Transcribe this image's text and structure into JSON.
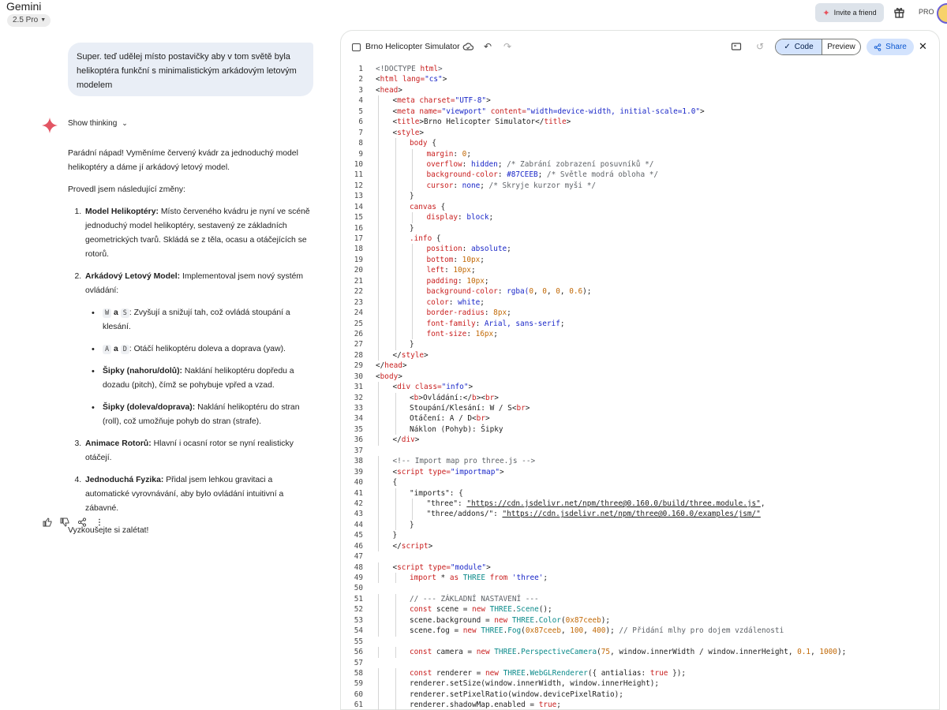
{
  "header": {
    "app_name": "Gemini",
    "model": "2.5 Pro",
    "invite_label": "Invite a friend",
    "pro_label": "PRO"
  },
  "chat": {
    "user_message": "Super. teď udělej místo postavičky aby v tom světě byla helikoptéra funkční s minimalistickým arkádovým letovým modelem",
    "show_thinking_label": "Show thinking",
    "intro": "Parádní nápad! Vyměníme červený kvádr za jednoduchý model helikoptéry a dáme jí arkádový letový model.",
    "changes_heading": "Provedl jsem následující změny:",
    "items": [
      {
        "title": "Model Helikoptéry:",
        "text": " Místo červeného kvádru je nyní ve scéně jednoduchý model helikoptéry, sestavený ze základních geometrických tvarů. Skládá se z těla, ocasu a otáčejících se rotorů."
      },
      {
        "title": "Arkádový Letový Model:",
        "text": " Implementoval jsem nový systém ovládání:"
      },
      {
        "title": "Animace Rotorů:",
        "text": " Hlavní i ocasní rotor se nyní realisticky otáčejí."
      },
      {
        "title": "Jednoduchá Fyzika:",
        "text": " Přidal jsem lehkou gravitaci a automatické vyrovnávání, aby bylo ovládání intuitivní a zábavné."
      }
    ],
    "controls": {
      "ws_key1": "W",
      "ws_conj": "a",
      "ws_key2": "S",
      "ws_text": ": Zvyšují a snižují tah, což ovládá stoupání a klesání.",
      "ad_key1": "A",
      "ad_conj": "a",
      "ad_key2": "D",
      "ad_text": ": Otáčí helikoptéru doleva a doprava (yaw).",
      "ud_title": "Šipky (nahoru/dolů):",
      "ud_text": " Naklání helikoptéru dopředu a dozadu (pitch), čímž se pohybuje vpřed a vzad.",
      "lr_title": "Šipky (doleva/doprava):",
      "lr_text": " Naklání helikoptéru do stran (roll), což umožňuje pohyb do stran (strafe)."
    },
    "outro": "Vyzkoušejte si zalétat!"
  },
  "editor": {
    "file_title": "Brno Helicopter Simulator",
    "code_tab": "Code",
    "preview_tab": "Preview",
    "share_label": "Share"
  },
  "colors": {
    "keyword": "#c92020",
    "attr": "#c92020",
    "string": "#1a27c8",
    "number": "#c26a08",
    "comment": "#5f6368",
    "klass": "#0b8a8a",
    "plain": "#1f1f1f",
    "prop": "#c92020"
  },
  "code_lines": [
    [
      [
        "<!DOCTYPE ",
        "comment"
      ],
      [
        "html",
        "keyword"
      ],
      [
        ">",
        "comment"
      ]
    ],
    [
      [
        "<",
        "plain"
      ],
      [
        "html",
        "keyword"
      ],
      [
        " lang=",
        "attr"
      ],
      [
        "\"cs\"",
        "string"
      ],
      [
        ">",
        "plain"
      ]
    ],
    [
      [
        "<",
        "plain"
      ],
      [
        "head",
        "keyword"
      ],
      [
        ">",
        "plain"
      ]
    ],
    [
      [
        "<",
        "plain"
      ],
      [
        "meta",
        "keyword"
      ],
      [
        " charset=",
        "attr"
      ],
      [
        "\"UTF-8\"",
        "string"
      ],
      [
        ">",
        "plain"
      ]
    ],
    [
      [
        "<",
        "plain"
      ],
      [
        "meta",
        "keyword"
      ],
      [
        " name=",
        "attr"
      ],
      [
        "\"viewport\"",
        "string"
      ],
      [
        " content=",
        "attr"
      ],
      [
        "\"width=device-width, initial-scale=1.0\"",
        "string"
      ],
      [
        ">",
        "plain"
      ]
    ],
    [
      [
        "<",
        "plain"
      ],
      [
        "title",
        "keyword"
      ],
      [
        ">Brno Helicopter Simulator</",
        "plain"
      ],
      [
        "title",
        "keyword"
      ],
      [
        ">",
        "plain"
      ]
    ],
    [
      [
        "<",
        "plain"
      ],
      [
        "style",
        "keyword"
      ],
      [
        ">",
        "plain"
      ]
    ],
    [
      [
        "body",
        "keyword"
      ],
      [
        " {",
        "plain"
      ]
    ],
    [
      [
        "margin",
        "prop"
      ],
      [
        ": ",
        "plain"
      ],
      [
        "0",
        "number"
      ],
      [
        ";",
        "plain"
      ]
    ],
    [
      [
        "overflow",
        "prop"
      ],
      [
        ": ",
        "plain"
      ],
      [
        "hidden",
        "string"
      ],
      [
        "; ",
        "plain"
      ],
      [
        "/* Zabrání zobrazení posuvníků */",
        "comment"
      ]
    ],
    [
      [
        "background-color",
        "prop"
      ],
      [
        ": ",
        "plain"
      ],
      [
        "#87CEEB",
        "string"
      ],
      [
        "; ",
        "plain"
      ],
      [
        "/* Světle modrá obloha */",
        "comment"
      ]
    ],
    [
      [
        "cursor",
        "prop"
      ],
      [
        ": ",
        "plain"
      ],
      [
        "none",
        "string"
      ],
      [
        "; ",
        "plain"
      ],
      [
        "/* Skryje kurzor myši */",
        "comment"
      ]
    ],
    [
      [
        "}",
        "plain"
      ]
    ],
    [
      [
        "canvas",
        "keyword"
      ],
      [
        " {",
        "plain"
      ]
    ],
    [
      [
        "display",
        "prop"
      ],
      [
        ": ",
        "plain"
      ],
      [
        "block",
        "string"
      ],
      [
        ";",
        "plain"
      ]
    ],
    [
      [
        "}",
        "plain"
      ]
    ],
    [
      [
        ".info",
        "keyword"
      ],
      [
        " {",
        "plain"
      ]
    ],
    [
      [
        "position",
        "prop"
      ],
      [
        ": ",
        "plain"
      ],
      [
        "absolute",
        "string"
      ],
      [
        ";",
        "plain"
      ]
    ],
    [
      [
        "bottom",
        "prop"
      ],
      [
        ": ",
        "plain"
      ],
      [
        "10px",
        "number"
      ],
      [
        ";",
        "plain"
      ]
    ],
    [
      [
        "left",
        "prop"
      ],
      [
        ": ",
        "plain"
      ],
      [
        "10px",
        "number"
      ],
      [
        ";",
        "plain"
      ]
    ],
    [
      [
        "padding",
        "prop"
      ],
      [
        ": ",
        "plain"
      ],
      [
        "10px",
        "number"
      ],
      [
        ";",
        "plain"
      ]
    ],
    [
      [
        "background-color",
        "prop"
      ],
      [
        ": ",
        "plain"
      ],
      [
        "rgba(",
        "string"
      ],
      [
        "0",
        "number"
      ],
      [
        ", ",
        "plain"
      ],
      [
        "0",
        "number"
      ],
      [
        ", ",
        "plain"
      ],
      [
        "0",
        "number"
      ],
      [
        ", ",
        "plain"
      ],
      [
        "0.6",
        "number"
      ],
      [
        ");",
        "plain"
      ]
    ],
    [
      [
        "color",
        "prop"
      ],
      [
        ": ",
        "plain"
      ],
      [
        "white",
        "string"
      ],
      [
        ";",
        "plain"
      ]
    ],
    [
      [
        "border-radius",
        "prop"
      ],
      [
        ": ",
        "plain"
      ],
      [
        "8px",
        "number"
      ],
      [
        ";",
        "plain"
      ]
    ],
    [
      [
        "font-family",
        "prop"
      ],
      [
        ": ",
        "plain"
      ],
      [
        "Arial, sans-serif",
        "string"
      ],
      [
        ";",
        "plain"
      ]
    ],
    [
      [
        "font-size",
        "prop"
      ],
      [
        ": ",
        "plain"
      ],
      [
        "16px",
        "number"
      ],
      [
        ";",
        "plain"
      ]
    ],
    [
      [
        "}",
        "plain"
      ]
    ],
    [
      [
        "</",
        "plain"
      ],
      [
        "style",
        "keyword"
      ],
      [
        ">",
        "plain"
      ]
    ],
    [
      [
        "</",
        "plain"
      ],
      [
        "head",
        "keyword"
      ],
      [
        ">",
        "plain"
      ]
    ],
    [
      [
        "<",
        "plain"
      ],
      [
        "body",
        "keyword"
      ],
      [
        ">",
        "plain"
      ]
    ],
    [
      [
        "<",
        "plain"
      ],
      [
        "div",
        "keyword"
      ],
      [
        " class=",
        "attr"
      ],
      [
        "\"info\"",
        "string"
      ],
      [
        ">",
        "plain"
      ]
    ],
    [
      [
        "<",
        "plain"
      ],
      [
        "b",
        "keyword"
      ],
      [
        ">Ovládání:</",
        "plain"
      ],
      [
        "b",
        "keyword"
      ],
      [
        "><",
        "plain"
      ],
      [
        "br",
        "keyword"
      ],
      [
        ">",
        "plain"
      ]
    ],
    [
      [
        "Stoupání/Klesání: W / S<",
        "plain"
      ],
      [
        "br",
        "keyword"
      ],
      [
        ">",
        "plain"
      ]
    ],
    [
      [
        "Otáčení: A / D<",
        "plain"
      ],
      [
        "br",
        "keyword"
      ],
      [
        ">",
        "plain"
      ]
    ],
    [
      [
        "Náklon (Pohyb): Šipky",
        "plain"
      ]
    ],
    [
      [
        "</",
        "plain"
      ],
      [
        "div",
        "keyword"
      ],
      [
        ">",
        "plain"
      ]
    ],
    [
      [
        "",
        "plain"
      ]
    ],
    [
      [
        "<!-- Import map pro three.js -->",
        "comment"
      ]
    ],
    [
      [
        "<",
        "plain"
      ],
      [
        "script",
        "keyword"
      ],
      [
        " type=",
        "attr"
      ],
      [
        "\"importmap\"",
        "string"
      ],
      [
        ">",
        "plain"
      ]
    ],
    [
      [
        "{",
        "plain"
      ]
    ],
    [
      [
        "\"imports\": {",
        "plain"
      ]
    ],
    [
      [
        "\"three\": ",
        "plain"
      ],
      [
        "\"https://cdn.jsdelivr.net/npm/three@0.160.0/build/three.module.js\"",
        "plain"
      ],
      [
        ",",
        "plain"
      ]
    ],
    [
      [
        "\"three/addons/\": ",
        "plain"
      ],
      [
        "\"https://cdn.jsdelivr.net/npm/three@0.160.0/examples/jsm/\"",
        "plain"
      ]
    ],
    [
      [
        "}",
        "plain"
      ]
    ],
    [
      [
        "}",
        "plain"
      ]
    ],
    [
      [
        "</",
        "plain"
      ],
      [
        "script",
        "keyword"
      ],
      [
        ">",
        "plain"
      ]
    ],
    [
      [
        "",
        "plain"
      ]
    ],
    [
      [
        "<",
        "plain"
      ],
      [
        "script",
        "keyword"
      ],
      [
        " type=",
        "attr"
      ],
      [
        "\"module\"",
        "string"
      ],
      [
        ">",
        "plain"
      ]
    ],
    [
      [
        "import",
        "keyword"
      ],
      [
        " * ",
        "plain"
      ],
      [
        "as",
        "keyword"
      ],
      [
        " ",
        "plain"
      ],
      [
        "THREE",
        "klass"
      ],
      [
        " ",
        "plain"
      ],
      [
        "from",
        "keyword"
      ],
      [
        " ",
        "plain"
      ],
      [
        "'three'",
        "string"
      ],
      [
        ";",
        "plain"
      ]
    ],
    [
      [
        "",
        "plain"
      ]
    ],
    [
      [
        "// --- ZÁKLADNÍ NASTAVENÍ ---",
        "comment"
      ]
    ],
    [
      [
        "const",
        "keyword"
      ],
      [
        " scene = ",
        "plain"
      ],
      [
        "new",
        "keyword"
      ],
      [
        " ",
        "plain"
      ],
      [
        "THREE",
        "klass"
      ],
      [
        ".",
        "plain"
      ],
      [
        "Scene",
        "klass"
      ],
      [
        "();",
        "plain"
      ]
    ],
    [
      [
        "scene.background = ",
        "plain"
      ],
      [
        "new",
        "keyword"
      ],
      [
        " ",
        "plain"
      ],
      [
        "THREE",
        "klass"
      ],
      [
        ".",
        "plain"
      ],
      [
        "Color",
        "klass"
      ],
      [
        "(",
        "plain"
      ],
      [
        "0x87ceeb",
        "number"
      ],
      [
        ");",
        "plain"
      ]
    ],
    [
      [
        "scene.fog = ",
        "plain"
      ],
      [
        "new",
        "keyword"
      ],
      [
        " ",
        "plain"
      ],
      [
        "THREE",
        "klass"
      ],
      [
        ".",
        "plain"
      ],
      [
        "Fog",
        "klass"
      ],
      [
        "(",
        "plain"
      ],
      [
        "0x87ceeb",
        "number"
      ],
      [
        ", ",
        "plain"
      ],
      [
        "100",
        "number"
      ],
      [
        ", ",
        "plain"
      ],
      [
        "400",
        "number"
      ],
      [
        "); ",
        "plain"
      ],
      [
        "// Přidání mlhy pro dojem vzdálenosti",
        "comment"
      ]
    ],
    [
      [
        "",
        "plain"
      ]
    ],
    [
      [
        "const",
        "keyword"
      ],
      [
        " camera = ",
        "plain"
      ],
      [
        "new",
        "keyword"
      ],
      [
        " ",
        "plain"
      ],
      [
        "THREE",
        "klass"
      ],
      [
        ".",
        "plain"
      ],
      [
        "PerspectiveCamera",
        "klass"
      ],
      [
        "(",
        "plain"
      ],
      [
        "75",
        "number"
      ],
      [
        ", window.innerWidth / window.innerHeight, ",
        "plain"
      ],
      [
        "0.1",
        "number"
      ],
      [
        ", ",
        "plain"
      ],
      [
        "1000",
        "number"
      ],
      [
        ");",
        "plain"
      ]
    ],
    [
      [
        "",
        "plain"
      ]
    ],
    [
      [
        "const",
        "keyword"
      ],
      [
        " renderer = ",
        "plain"
      ],
      [
        "new",
        "keyword"
      ],
      [
        " ",
        "plain"
      ],
      [
        "THREE",
        "klass"
      ],
      [
        ".",
        "plain"
      ],
      [
        "WebGLRenderer",
        "klass"
      ],
      [
        "({ antialias: ",
        "plain"
      ],
      [
        "true",
        "keyword"
      ],
      [
        " });",
        "plain"
      ]
    ],
    [
      [
        "renderer.setSize(window.innerWidth, window.innerHeight);",
        "plain"
      ]
    ],
    [
      [
        "renderer.setPixelRatio(window.devicePixelRatio);",
        "plain"
      ]
    ],
    [
      [
        "renderer.shadowMap.enabled = ",
        "plain"
      ],
      [
        "true",
        "keyword"
      ],
      [
        ";",
        "plain"
      ]
    ]
  ]
}
